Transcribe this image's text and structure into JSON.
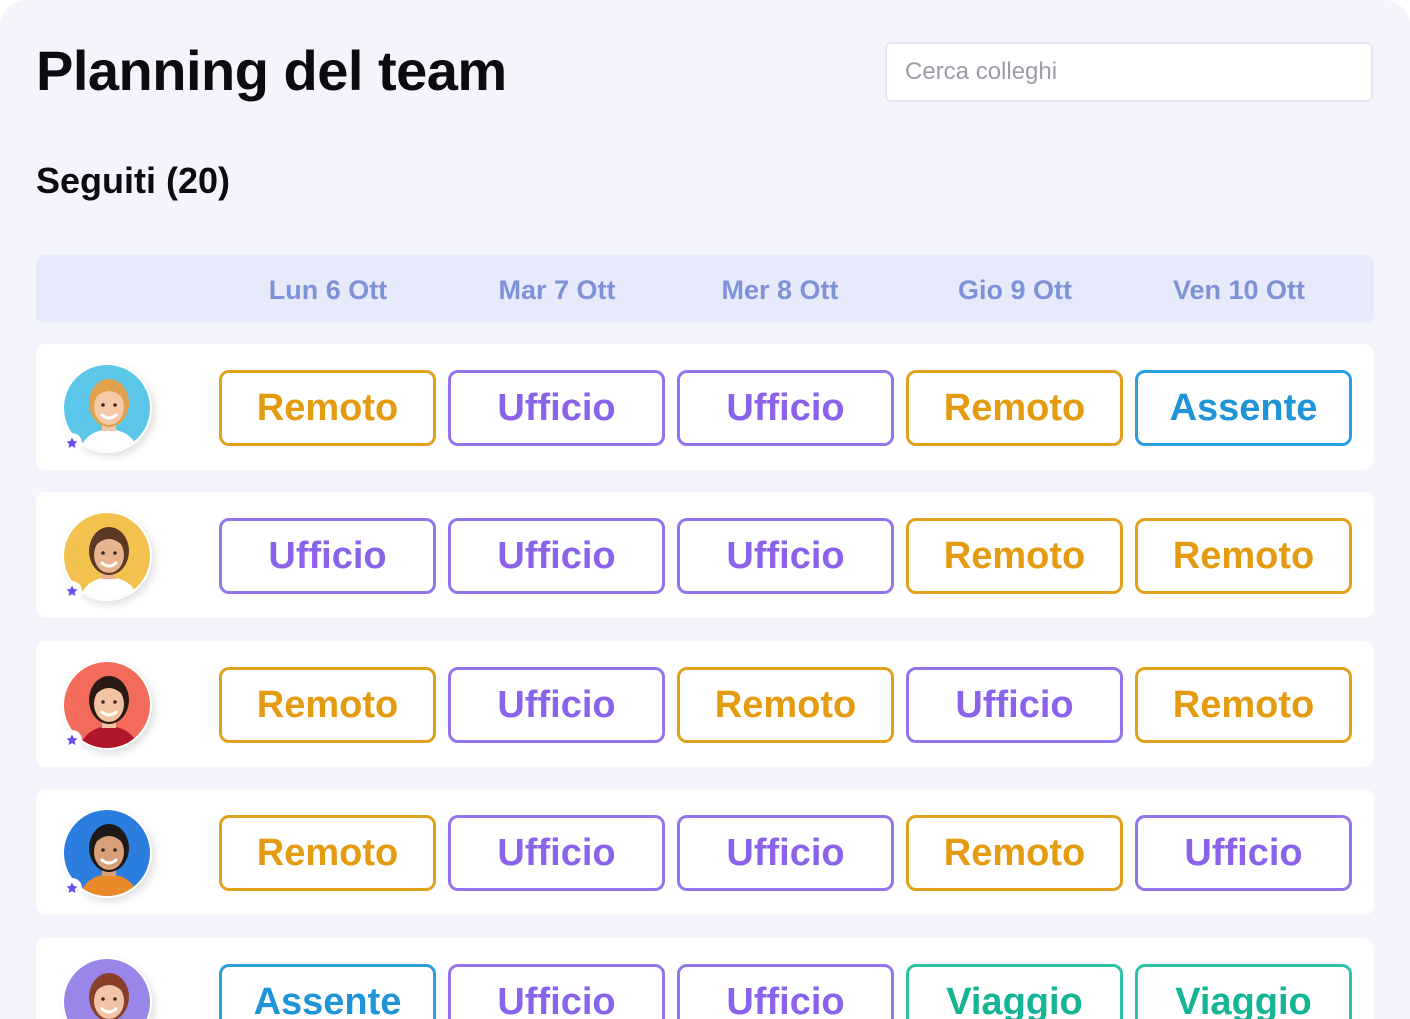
{
  "page_title": "Planning del team",
  "search": {
    "placeholder": "Cerca colleghi"
  },
  "section_title": "Seguiti (20)",
  "days": [
    "Lun 6 Ott",
    "Mar 7 Ott",
    "Mer 8 Ott",
    "Gio 9 Ott",
    "Ven 10 Ott"
  ],
  "status_colors": {
    "Remoto": "#e0a21c",
    "Ufficio": "#9474ea",
    "Assente": "#2a9fdf",
    "Viaggio": "#2cc4a6"
  },
  "rows": [
    {
      "avatar_bg": "#5bc6e8",
      "favorite": true,
      "statuses": [
        "Remoto",
        "Ufficio",
        "Ufficio",
        "Remoto",
        "Assente"
      ]
    },
    {
      "avatar_bg": "#f2c14e",
      "favorite": true,
      "statuses": [
        "Ufficio",
        "Ufficio",
        "Ufficio",
        "Remoto",
        "Remoto"
      ]
    },
    {
      "avatar_bg": "#f26b5b",
      "favorite": true,
      "statuses": [
        "Remoto",
        "Ufficio",
        "Remoto",
        "Ufficio",
        "Remoto"
      ]
    },
    {
      "avatar_bg": "#2b7de0",
      "favorite": true,
      "statuses": [
        "Remoto",
        "Ufficio",
        "Ufficio",
        "Remoto",
        "Ufficio"
      ]
    },
    {
      "avatar_bg": "#9a86e8",
      "favorite": false,
      "statuses": [
        "Assente",
        "Ufficio",
        "Ufficio",
        "Viaggio",
        "Viaggio"
      ]
    }
  ]
}
